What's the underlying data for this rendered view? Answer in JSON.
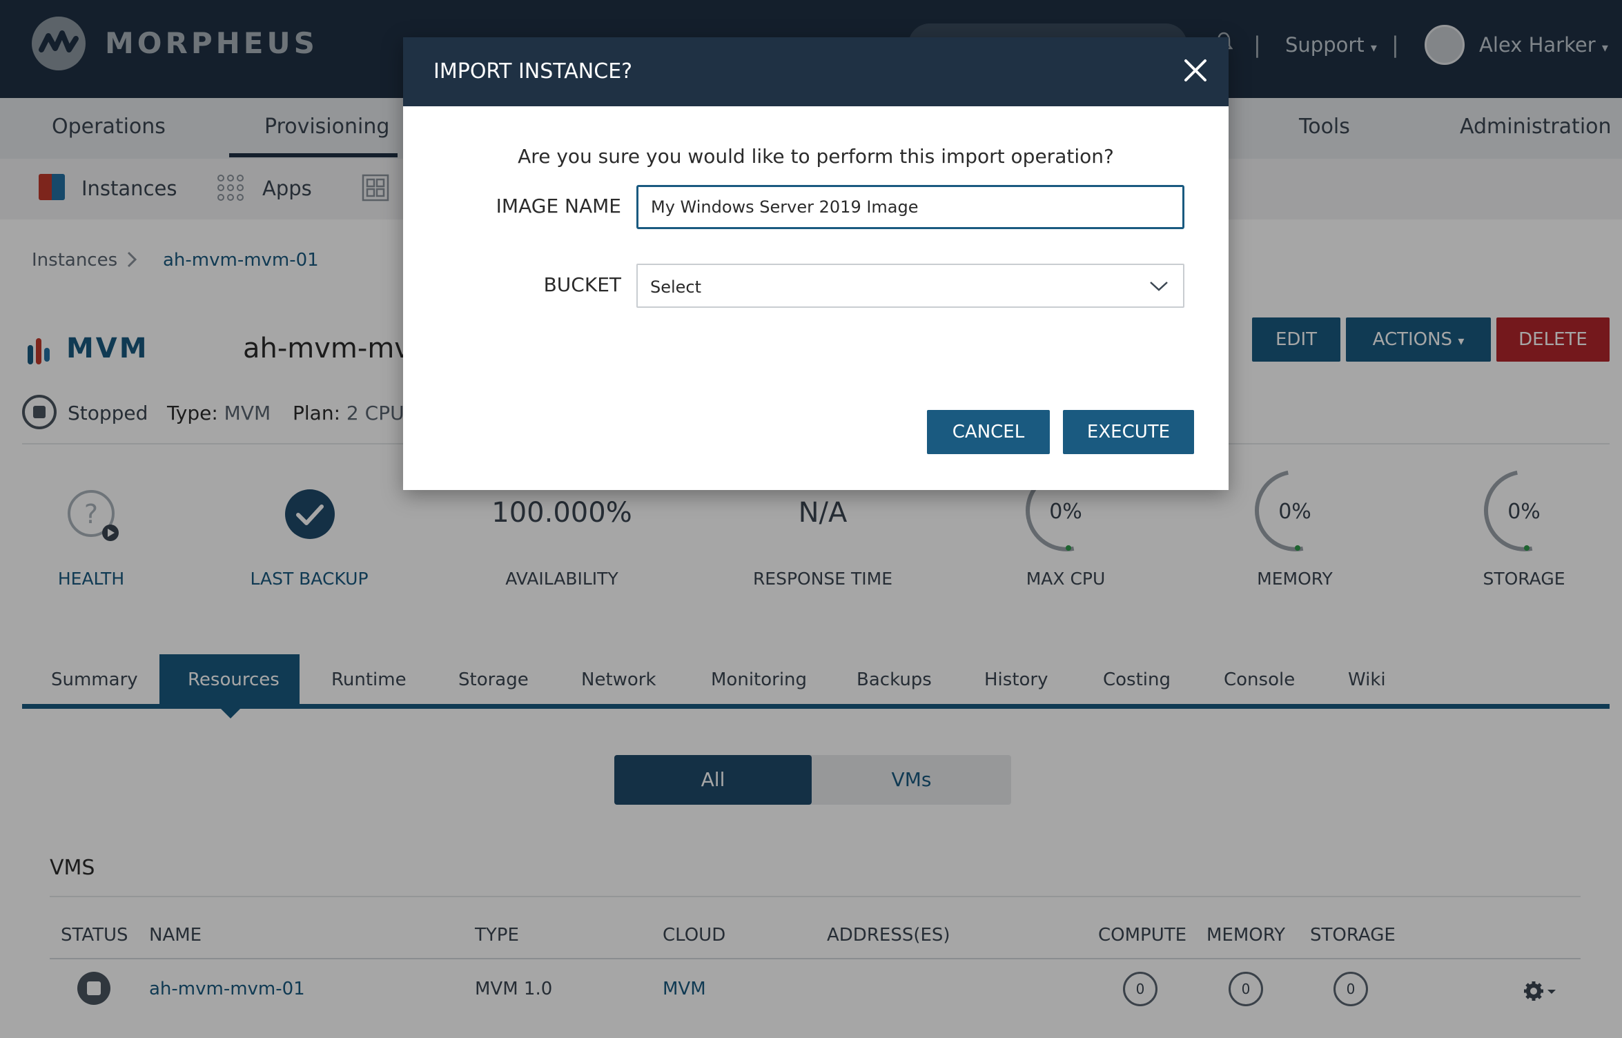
{
  "brand": {
    "name": "MORPHEUS"
  },
  "topbar": {
    "support": "Support",
    "user_name": "Alex Harker",
    "separator": "|"
  },
  "main_nav": [
    "Operations",
    "Provisioning",
    "Tools",
    "Administration"
  ],
  "sub_nav": {
    "instances": "Instances",
    "apps": "Apps"
  },
  "breadcrumb": {
    "root": "Instances",
    "current": "ah-mvm-mvm-01"
  },
  "instance": {
    "logo_text": "MVM",
    "name": "ah-mvm-mv",
    "status": "Stopped",
    "type_label": "Type:",
    "type_value": "MVM",
    "plan_label": "Plan:",
    "plan_value": "2 CPU,"
  },
  "header_buttons": {
    "edit": "EDIT",
    "actions": "ACTIONS",
    "delete": "DELETE"
  },
  "stats": {
    "health": "HEALTH",
    "last_backup": "LAST BACKUP",
    "availability_value": "100.000%",
    "availability": "AVAILABILITY",
    "response_value": "N/A",
    "response": "RESPONSE TIME",
    "max_cpu_value": "0%",
    "max_cpu": "MAX CPU",
    "memory_value": "0%",
    "memory": "MEMORY",
    "storage_value": "0%",
    "storage": "STORAGE"
  },
  "tabs": [
    "Summary",
    "Resources",
    "Runtime",
    "Storage",
    "Network",
    "Monitoring",
    "Backups",
    "History",
    "Costing",
    "Console",
    "Wiki"
  ],
  "filter": {
    "all": "All",
    "vms": "VMs"
  },
  "vms_section": {
    "title": "VMS",
    "columns": [
      "STATUS",
      "NAME",
      "TYPE",
      "CLOUD",
      "ADDRESS(ES)",
      "COMPUTE",
      "MEMORY",
      "STORAGE"
    ],
    "row": {
      "name": "ah-mvm-mvm-01",
      "type": "MVM 1.0",
      "cloud": "MVM",
      "compute": "0",
      "memory": "0",
      "storage": "0"
    }
  },
  "modal": {
    "title": "IMPORT INSTANCE?",
    "message": "Are you sure you would like to perform this import operation?",
    "image_name_label": "IMAGE NAME",
    "image_name_value": "My Windows Server 2019 Image",
    "bucket_label": "BUCKET",
    "bucket_value": "Select",
    "cancel": "CANCEL",
    "execute": "EXECUTE"
  },
  "colors": {
    "navy": "#1f3144",
    "accent_blue": "#1a5a80",
    "delete_red": "#b2262b",
    "success_green": "#2f9a4b"
  }
}
